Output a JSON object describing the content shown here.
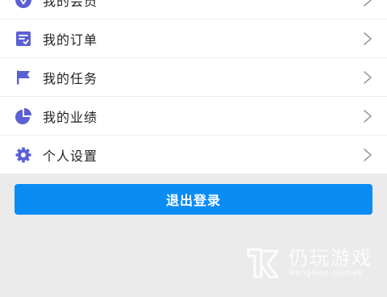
{
  "menu": {
    "items": [
      {
        "label": "我的会员",
        "icon": "vip-diamond-icon"
      },
      {
        "label": "我的订单",
        "icon": "order-checklist-icon"
      },
      {
        "label": "我的任务",
        "icon": "flag-icon"
      },
      {
        "label": "我的业绩",
        "icon": "pie-chart-icon"
      },
      {
        "label": "个人设置",
        "icon": "gear-icon"
      }
    ],
    "chevron_icon": "chevron-right-icon",
    "icon_color": "#5b5fd4"
  },
  "logout": {
    "label": "退出登录",
    "color": "#0a8cf5"
  },
  "watermark": {
    "title": "仍玩游戏",
    "subtitle": "Rengwan Games"
  }
}
